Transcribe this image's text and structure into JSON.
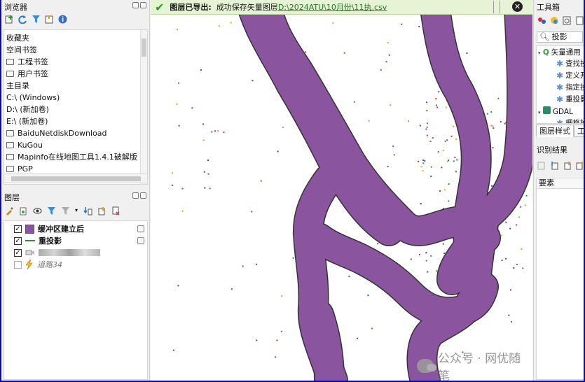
{
  "browser_panel": {
    "title": "浏览器",
    "toolbar_icons": [
      "add-icon",
      "refresh-icon",
      "filter-icon",
      "collapse-icon",
      "info-icon"
    ],
    "items": [
      {
        "label": "收藏夹",
        "folder": false
      },
      {
        "label": "空间书签",
        "folder": false
      },
      {
        "label": "工程书签",
        "folder": true
      },
      {
        "label": "用户书签",
        "folder": true
      },
      {
        "label": "主目录",
        "folder": false
      },
      {
        "label": "C:\\ (Windows)",
        "folder": false
      },
      {
        "label": "D:\\ (新加卷)",
        "folder": false
      },
      {
        "label": "E:\\ (新加卷)",
        "folder": false
      },
      {
        "label": "BaiduNetdiskDownload",
        "folder": true
      },
      {
        "label": "KuGou",
        "folder": true
      },
      {
        "label": "Mapinfo在线地图工具1.4.1破解版",
        "folder": true
      },
      {
        "label": "PGP",
        "folder": true
      }
    ]
  },
  "layers_panel": {
    "title": "图层",
    "layers": [
      {
        "label": "缓冲区建立后",
        "checked": true,
        "symbol": "polygon",
        "bold": true
      },
      {
        "label": "重投影",
        "checked": true,
        "symbol": "line",
        "bold": true
      },
      {
        "label": "",
        "checked": true,
        "symbol": "point",
        "bold": false
      },
      {
        "label": "道路34",
        "checked": false,
        "symbol": "lightning",
        "bold": false
      }
    ]
  },
  "message_bar": {
    "title": "图层已导出:",
    "text": "成功保存矢量图层",
    "link": "D:\\2024ATU\\10月份\\11执.csv"
  },
  "watermark": {
    "text": "公众号 · 网优随笔"
  },
  "toolbox": {
    "title": "工具箱",
    "search_value": "投影",
    "items": [
      {
        "label": "矢量通用",
        "type": "group-q",
        "indent": 0
      },
      {
        "label": "查找投",
        "type": "tool",
        "indent": 1
      },
      {
        "label": "定义开",
        "type": "tool",
        "indent": 1
      },
      {
        "label": "指定投",
        "type": "tool",
        "indent": 1
      },
      {
        "label": "重投影",
        "type": "tool",
        "indent": 1
      },
      {
        "label": "GDAL",
        "type": "group-gdal",
        "indent": 0
      },
      {
        "label": "栅格投影",
        "type": "tool",
        "indent": 1
      }
    ],
    "tabs": [
      "图层样式",
      "工"
    ],
    "ident_title": "识别结果",
    "ident_column": "要素"
  },
  "colors": {
    "buffer_fill": "#8a559e",
    "buffer_stroke": "#333333",
    "message_bg": "#e6f3d4"
  }
}
